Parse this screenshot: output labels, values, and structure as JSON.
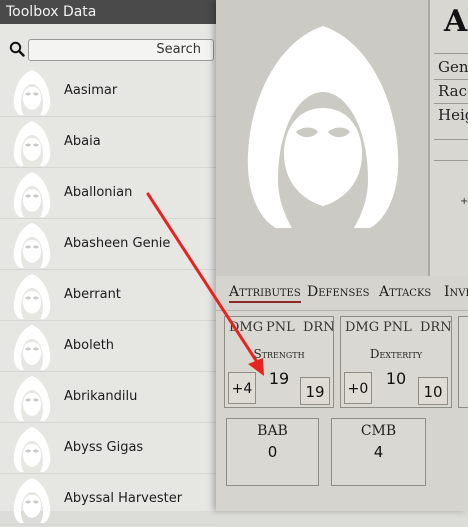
{
  "left_panel": {
    "title": "Toolbox Data",
    "search": {
      "placeholder": "Search",
      "icon": "search-icon"
    },
    "items": [
      {
        "label": "Aasimar"
      },
      {
        "label": "Abaia"
      },
      {
        "label": "Aballonian"
      },
      {
        "label": "Abasheen Genie"
      },
      {
        "label": "Aberrant"
      },
      {
        "label": "Aboleth"
      },
      {
        "label": "Abrikandilu"
      },
      {
        "label": "Abyss Gigas"
      },
      {
        "label": "Abyssal Harvester"
      }
    ]
  },
  "sheet": {
    "name": "Ab",
    "fields": {
      "gender": "Gende",
      "race": "Race",
      "height": "Heigh"
    },
    "tabs": {
      "attributes": "Attributes",
      "defenses": "Defenses",
      "attacks": "Attacks",
      "inventory": "Inve"
    },
    "ability_columns": {
      "dmg": "DMG",
      "pnl": "PNL",
      "drn": "DRN"
    },
    "strength": {
      "name": "Strength",
      "score": "19",
      "mod": "+4",
      "temp": "19"
    },
    "dexterity": {
      "name": "Dexterity",
      "score": "10",
      "mod": "+0",
      "temp": "10"
    },
    "bab": {
      "label": "BAB",
      "value": "0"
    },
    "cmb": {
      "label": "CMB",
      "value": "4"
    },
    "info_small": "+"
  },
  "annotation": {
    "arrow_color": "#e8231f"
  }
}
